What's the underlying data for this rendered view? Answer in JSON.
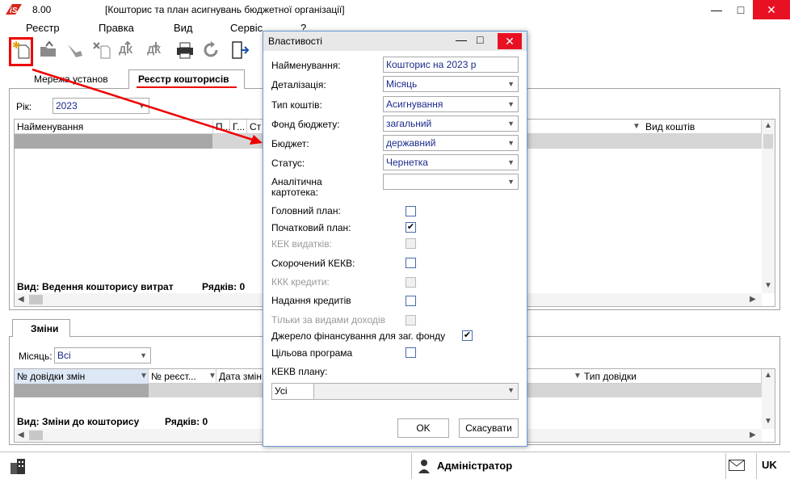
{
  "window": {
    "version": "8.00",
    "title": "[Кошторис та план асигнувань бюджетної організації]",
    "minimize": "—",
    "maximize": "□",
    "close": "✕"
  },
  "menu": [
    "Реєстр",
    "Правка",
    "Вид",
    "Сервіс",
    "?"
  ],
  "toolbar": {
    "icons": [
      "new-document-icon",
      "open-folder-icon",
      "edit-icon",
      "delete-icon",
      "debit-credit-icon",
      "debit-credit-down-icon",
      "print-icon",
      "refresh-icon",
      "exit-icon"
    ]
  },
  "top_tabs": [
    "Мережа установ",
    "Реєстр кошторисів"
  ],
  "year": {
    "label": "Рік:",
    "value": "2023"
  },
  "grid1": {
    "columns": [
      "Найменування",
      "П...",
      "Г...",
      "Ст",
      "Вид коштів"
    ],
    "footer_view": "Вид: Ведення кошторису витрат",
    "footer_rows": "Рядків: 0"
  },
  "bottom_tab": "Зміни",
  "month": {
    "label": "Місяць:",
    "value": "Всі"
  },
  "grid2": {
    "columns": [
      "№ довідки змін",
      "№ реєст...",
      "Дата змін",
      "Тип довідки"
    ],
    "footer_view": "Вид: Зміни до кошторису",
    "footer_rows": "Рядків: 0"
  },
  "dialog": {
    "title": "Властивості",
    "fields": {
      "name_label": "Найменування:",
      "name_value": "Кошторис на 2023 р",
      "detail_label": "Деталізація:",
      "detail_value": "Місяць",
      "funds_label": "Тип коштів:",
      "funds_value": "Асигнування",
      "fund_label": "Фонд бюджету:",
      "fund_value": "загальний",
      "budget_label": "Бюджет:",
      "budget_value": "державний",
      "status_label": "Статус:",
      "status_value": "Чернетка",
      "card_label": "Аналітична картотека:",
      "card_value": ""
    },
    "checks": {
      "main_plan": "Головний план:",
      "initial_plan": "Початковий план:",
      "kek": "КЕК видатків:",
      "short_kekv": "Скорочений КЕКВ:",
      "kkk": "ККК кредити:",
      "credits": "Надання кредитів",
      "income_only": "Тільки за видами доходів",
      "source": "Джерело фінансування для заг. фонду",
      "program": "Цільова програма",
      "kekv_plan": "КЕКВ плану:"
    },
    "check_mark": "✔",
    "kekv_value": "Усі",
    "ok": "OK",
    "cancel": "Скасувати"
  },
  "status": {
    "user": "Адміністратор",
    "lang": "UK"
  },
  "colors": {
    "accent": "#1a2a8a",
    "highlight": "#e00000",
    "close": "#e81123"
  }
}
